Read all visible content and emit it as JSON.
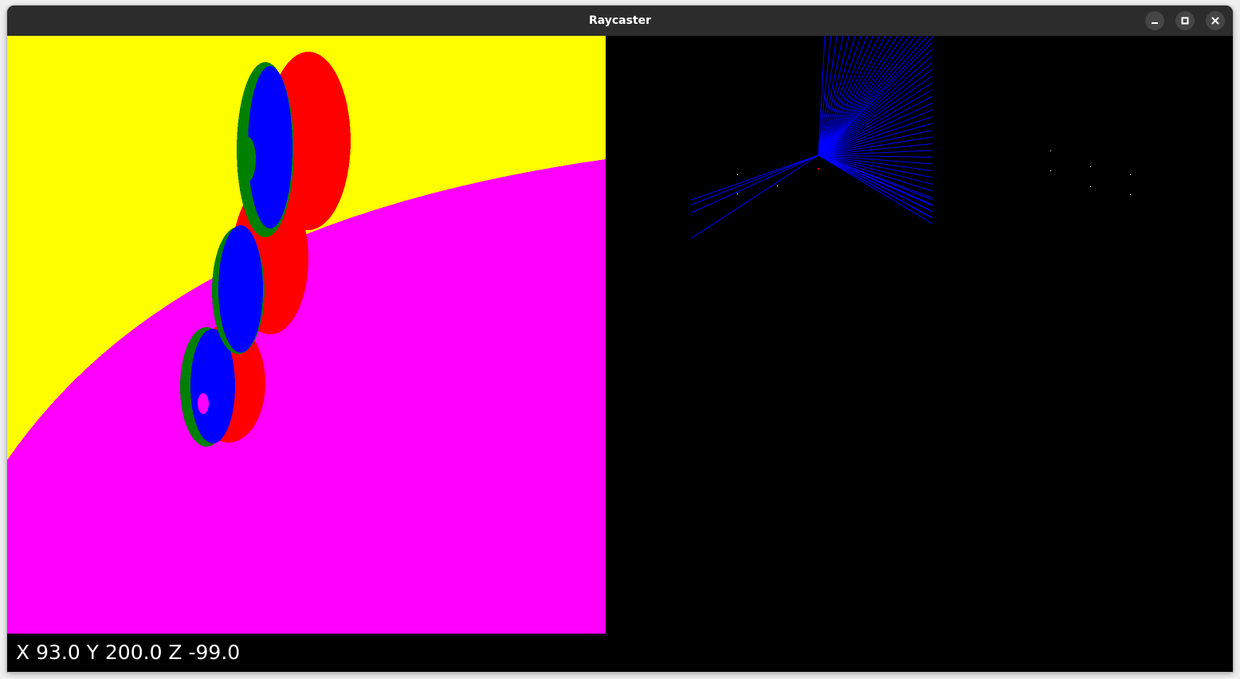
{
  "window": {
    "title": "Raycaster"
  },
  "controls": {
    "minimize_icon": "minimize-icon",
    "maximize_icon": "maximize-icon",
    "close_icon": "close-icon"
  },
  "status": {
    "coordinates": "X 93.0 Y 200.0 Z -99.0"
  },
  "colors": {
    "titlebar": "#2c2c2c",
    "background": "#000000",
    "sky": "#ffff00",
    "floor": "#ff00ff",
    "sphere_red": "#ff0000",
    "sphere_blue": "#0000ff",
    "sphere_green": "#008000",
    "rays": "#0000ff"
  }
}
